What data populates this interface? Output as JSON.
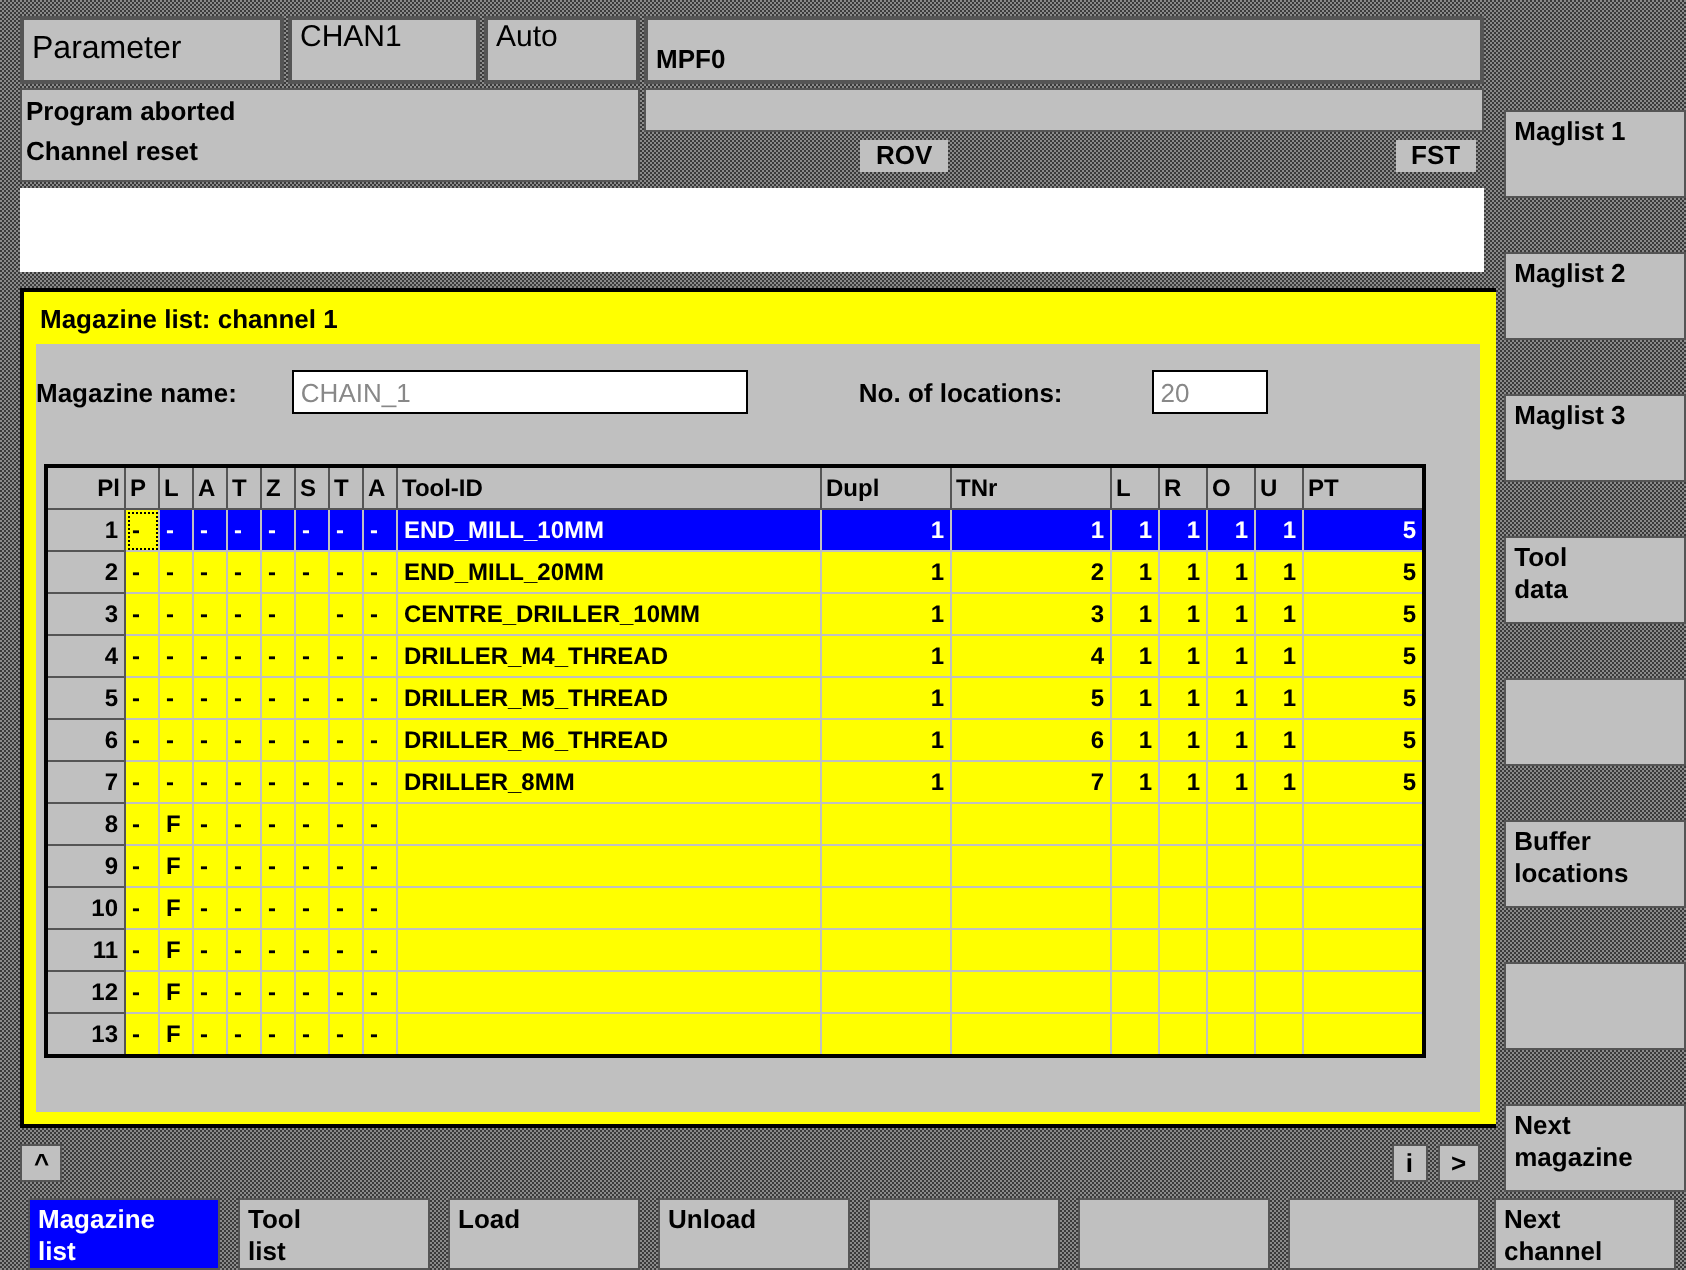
{
  "header": {
    "title": "Parameter",
    "channel": "CHAN1",
    "mode": "Auto",
    "program": "MPF0",
    "messages": [
      "Program aborted",
      "Channel reset"
    ],
    "indicators": [
      "ROV",
      "FST"
    ]
  },
  "panel": {
    "title": "Magazine list: channel 1",
    "fields": [
      {
        "label": "Magazine name:",
        "value": "CHAIN_1"
      },
      {
        "label": "No. of locations:",
        "value": "20"
      }
    ]
  },
  "table": {
    "columns": [
      "Pl",
      "P",
      "L",
      "A",
      "T",
      "Z",
      "S",
      "T",
      "A",
      "Tool-ID",
      "Dupl",
      "TNr",
      "L",
      "R",
      "O",
      "U",
      "PT"
    ],
    "rows": [
      {
        "selected": true,
        "cells": [
          "1",
          "-",
          "-",
          "-",
          "-",
          "-",
          "-",
          "-",
          "-",
          "END_MILL_10MM",
          "1",
          "1",
          "1",
          "1",
          "1",
          "1",
          "5"
        ]
      },
      {
        "selected": false,
        "cells": [
          "2",
          "-",
          "-",
          "-",
          "-",
          "-",
          "-",
          "-",
          "-",
          "END_MILL_20MM",
          "1",
          "2",
          "1",
          "1",
          "1",
          "1",
          "5"
        ]
      },
      {
        "selected": false,
        "cells": [
          "3",
          "-",
          "-",
          "-",
          "-",
          "-",
          null,
          "-",
          "-",
          "CENTRE_DRILLER_10MM",
          "1",
          "3",
          "1",
          "1",
          "1",
          "1",
          "5"
        ]
      },
      {
        "selected": false,
        "cells": [
          "4",
          "-",
          "-",
          "-",
          "-",
          "-",
          "-",
          "-",
          "-",
          "DRILLER_M4_THREAD",
          "1",
          "4",
          "1",
          "1",
          "1",
          "1",
          "5"
        ]
      },
      {
        "selected": false,
        "cells": [
          "5",
          "-",
          "-",
          "-",
          "-",
          "-",
          "-",
          "-",
          "-",
          "DRILLER_M5_THREAD",
          "1",
          "5",
          "1",
          "1",
          "1",
          "1",
          "5"
        ]
      },
      {
        "selected": false,
        "cells": [
          "6",
          "-",
          "-",
          "-",
          "-",
          "-",
          "-",
          "-",
          "-",
          "DRILLER_M6_THREAD",
          "1",
          "6",
          "1",
          "1",
          "1",
          "1",
          "5"
        ]
      },
      {
        "selected": false,
        "cells": [
          "7",
          "-",
          "-",
          "-",
          "-",
          "-",
          "-",
          "-",
          "-",
          "DRILLER_8MM",
          "1",
          "7",
          "1",
          "1",
          "1",
          "1",
          "5"
        ]
      },
      {
        "selected": false,
        "cells": [
          "8",
          "-",
          "F",
          "-",
          "-",
          "-",
          "-",
          "-",
          "-",
          null,
          null,
          null,
          null,
          null,
          null,
          null,
          null
        ]
      },
      {
        "selected": false,
        "cells": [
          "9",
          "-",
          "F",
          "-",
          "-",
          "-",
          "-",
          "-",
          "-",
          null,
          null,
          null,
          null,
          null,
          null,
          null,
          null
        ]
      },
      {
        "selected": false,
        "cells": [
          "10",
          "-",
          "F",
          "-",
          "-",
          "-",
          "-",
          "-",
          "-",
          null,
          null,
          null,
          null,
          null,
          null,
          null,
          null
        ]
      },
      {
        "selected": false,
        "cells": [
          "11",
          "-",
          "F",
          "-",
          "-",
          "-",
          "-",
          "-",
          "-",
          null,
          null,
          null,
          null,
          null,
          null,
          null,
          null
        ]
      },
      {
        "selected": false,
        "cells": [
          "12",
          "-",
          "F",
          "-",
          "-",
          "-",
          "-",
          "-",
          "-",
          null,
          null,
          null,
          null,
          null,
          null,
          null,
          null
        ]
      },
      {
        "selected": false,
        "cells": [
          "13",
          "-",
          "F",
          "-",
          "-",
          "-",
          "-",
          "-",
          "-",
          null,
          null,
          null,
          null,
          null,
          null,
          null,
          null
        ]
      }
    ]
  },
  "nav": {
    "up": "^",
    "info": "i",
    "next": ">"
  },
  "vertical_softkeys": [
    {
      "kind": "labeled",
      "label": "Maglist 1"
    },
    {
      "kind": "labeled",
      "label": "Maglist 2"
    },
    {
      "kind": "labeled",
      "label": "Maglist 3"
    },
    {
      "kind": "labeled",
      "label": "Tool\ndata"
    },
    {
      "kind": "blank"
    },
    {
      "kind": "labeled",
      "label": "Buffer\nlocations"
    },
    {
      "kind": "blank"
    },
    {
      "kind": "labeled",
      "label": "Next\nmagazine"
    }
  ],
  "horizontal_softkeys": [
    {
      "label": "Magazine\nlist",
      "selected": true
    },
    {
      "label": "Tool\nlist",
      "selected": false
    },
    {
      "label": "Load",
      "selected": false
    },
    {
      "label": "Unload",
      "selected": false
    },
    {
      "selected": false
    },
    {
      "selected": false
    },
    {
      "selected": false
    },
    {
      "label": "Next\nchannel",
      "selected": false
    }
  ]
}
